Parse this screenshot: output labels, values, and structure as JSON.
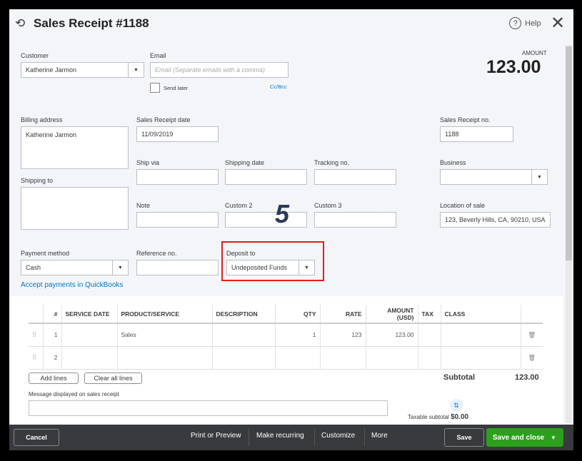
{
  "header": {
    "title": "Sales Receipt #1188",
    "help": "Help",
    "amount_label": "AMOUNT",
    "amount": "123.00"
  },
  "form": {
    "customer_label": "Customer",
    "customer": "Katherine Jarmon",
    "email_label": "Email",
    "email_placeholder": "Email (Separate emails with a comma)",
    "send_later": "Send later",
    "ccbcc": "Cc/Bcc",
    "billing_label": "Billing address",
    "billing": "Katherine Jarmon",
    "date_label": "Sales Receipt date",
    "date": "11/09/2019",
    "receipt_no_label": "Sales Receipt no.",
    "receipt_no": "1188",
    "ship_via_label": "Ship via",
    "shipping_date_label": "Shipping date",
    "tracking_label": "Tracking no.",
    "business_label": "Business",
    "shipping_to_label": "Shipping to",
    "note_label": "Note",
    "custom2_label": "Custom 2",
    "custom3_label": "Custom 3",
    "location_label": "Location of sale",
    "location": "123, Beverly Hills, CA, 90210, USA",
    "payment_label": "Payment method",
    "payment": "Cash",
    "reference_label": "Reference no.",
    "deposit_label": "Deposit to",
    "deposit": "Undeposited Funds",
    "accept_link": "Accept payments in QuickBooks",
    "annotation": "5"
  },
  "table": {
    "headers": [
      "#",
      "SERVICE DATE",
      "PRODUCT/SERVICE",
      "DESCRIPTION",
      "QTY",
      "RATE",
      "AMOUNT (USD)",
      "TAX",
      "CLASS"
    ],
    "rows": [
      {
        "n": "1",
        "date": "",
        "product": "Sales",
        "desc": "",
        "qty": "1",
        "rate": "123",
        "amount": "123.00",
        "tax": "",
        "class": ""
      },
      {
        "n": "2",
        "date": "",
        "product": "",
        "desc": "",
        "qty": "",
        "rate": "",
        "amount": "",
        "tax": "",
        "class": ""
      }
    ],
    "add_lines": "Add lines",
    "clear_lines": "Clear all lines",
    "subtotal_label": "Subtotal",
    "subtotal": "123.00",
    "message_label": "Message displayed on sales receipt",
    "taxable_label": "Taxable subtotal",
    "taxable": "$0.00"
  },
  "footer": {
    "cancel": "Cancel",
    "print": "Print or Preview",
    "recurring": "Make recurring",
    "customize": "Customize",
    "more": "More",
    "save": "Save",
    "save_close": "Save and close"
  },
  "colors": {
    "accent": "#2ca01c",
    "link": "#0077c5",
    "highlight": "#e01e1e",
    "footer": "#393a3d"
  }
}
